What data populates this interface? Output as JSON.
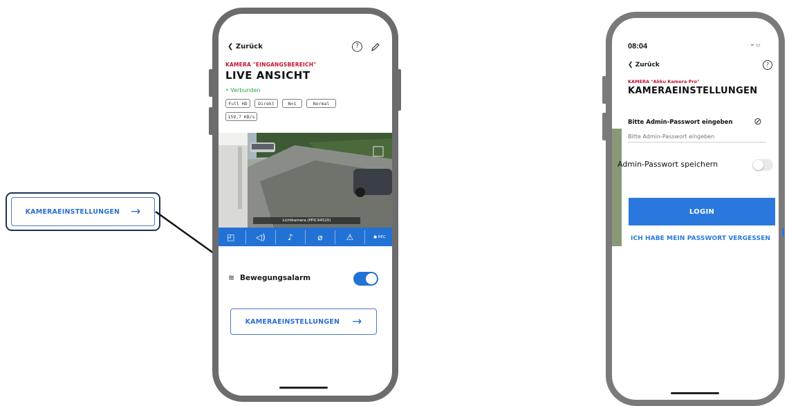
{
  "callout": {
    "button_label": "KAMERAEINSTELLUNGEN",
    "arrow": "→"
  },
  "phone1": {
    "back_label": "Zurück",
    "camera_name": "KAMERA \"EINGANGSBEREICH\"",
    "title": "LIVE ANSICHT",
    "status": "• Verbunden",
    "badges": [
      "Full HD",
      "Direkt",
      "N=1",
      "Normal",
      "159,7 KB/s"
    ],
    "video_caption": "Lichtkamera (PPIC44520)",
    "toolbar": {
      "rec_label": "● REC"
    },
    "motion_label": "Bewegungsalarm",
    "motion_enabled": true,
    "settings_label": "KAMERAEINSTELLUNGEN",
    "arrow": "→"
  },
  "phone2": {
    "time": "08:04",
    "back_label": "Zurück",
    "camera_name": "KAMERA \"Akku Kamera Pro\"",
    "title": "KAMERAEINSTELLUNGEN",
    "password_label": "Bitte Admin-Passwort eingeben",
    "password_placeholder": "Bitte Admin-Passwort eingeben",
    "save_label": "Admin-Passwort speichern",
    "save_enabled": false,
    "login_label": "LOGIN",
    "forgot_label": "ICH HABE MEIN PASSWORT VERGESSEN"
  },
  "colors": {
    "accent": "#2272d6",
    "brand_red": "#c3122c",
    "connected": "#2ea44f",
    "frame": "#6c6c6c"
  }
}
